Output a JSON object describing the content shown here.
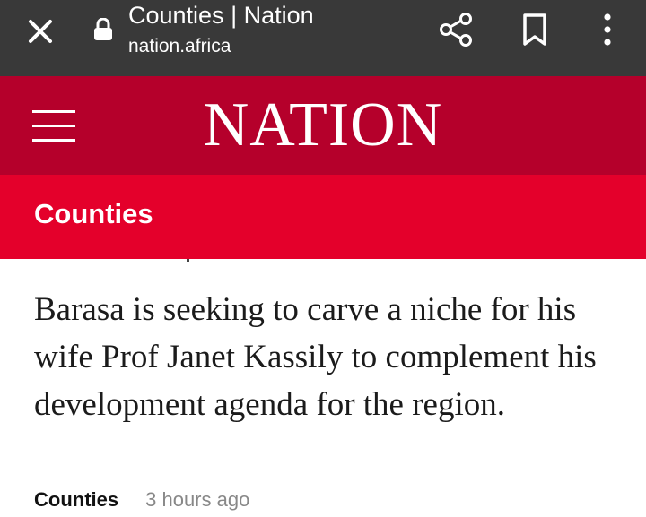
{
  "browser": {
    "title": "Counties | Nation",
    "url": "nation.africa",
    "icons": [
      "close-icon",
      "lock-icon",
      "share-icon",
      "bookmark-icon",
      "more-vertical-icon"
    ]
  },
  "site": {
    "brand": "NATION",
    "colors": {
      "header": "#b5002b",
      "section_band": "#e4002b",
      "browser_bar": "#393939"
    },
    "menu_icon": "hamburger-menu-icon"
  },
  "section": {
    "title": "Counties"
  },
  "article": {
    "summary": "Barasa is seeking to carve a niche for his wife Prof Janet Kassily to complement his development agenda for the region.",
    "category": "Counties",
    "time": "3 hours ago"
  }
}
